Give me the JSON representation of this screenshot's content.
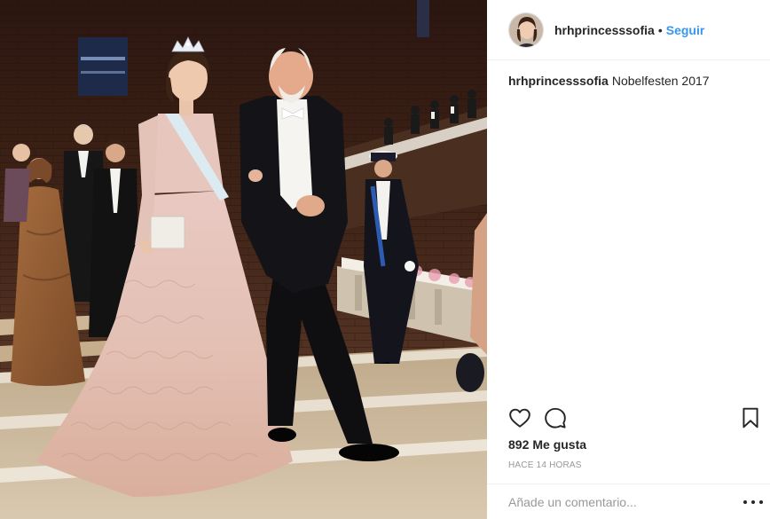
{
  "post": {
    "username": "hrhprincesssofia",
    "separator": "•",
    "follow_label": "Seguir",
    "caption_user": "hrhprincesssofia",
    "caption_text": "Nobelfesten 2017",
    "likes_count": "892",
    "likes_label": "Me gusta",
    "time_ago": "HACE 14 HORAS",
    "comment_placeholder": "Añade un comentario..."
  },
  "icons": {
    "like": "heart-outline-icon",
    "comment": "speech-bubble-icon",
    "save": "bookmark-icon",
    "more": "ellipsis-icon"
  },
  "colors": {
    "link": "#3897f0",
    "text": "#262626",
    "muted": "#999999",
    "divider": "#efefef"
  }
}
